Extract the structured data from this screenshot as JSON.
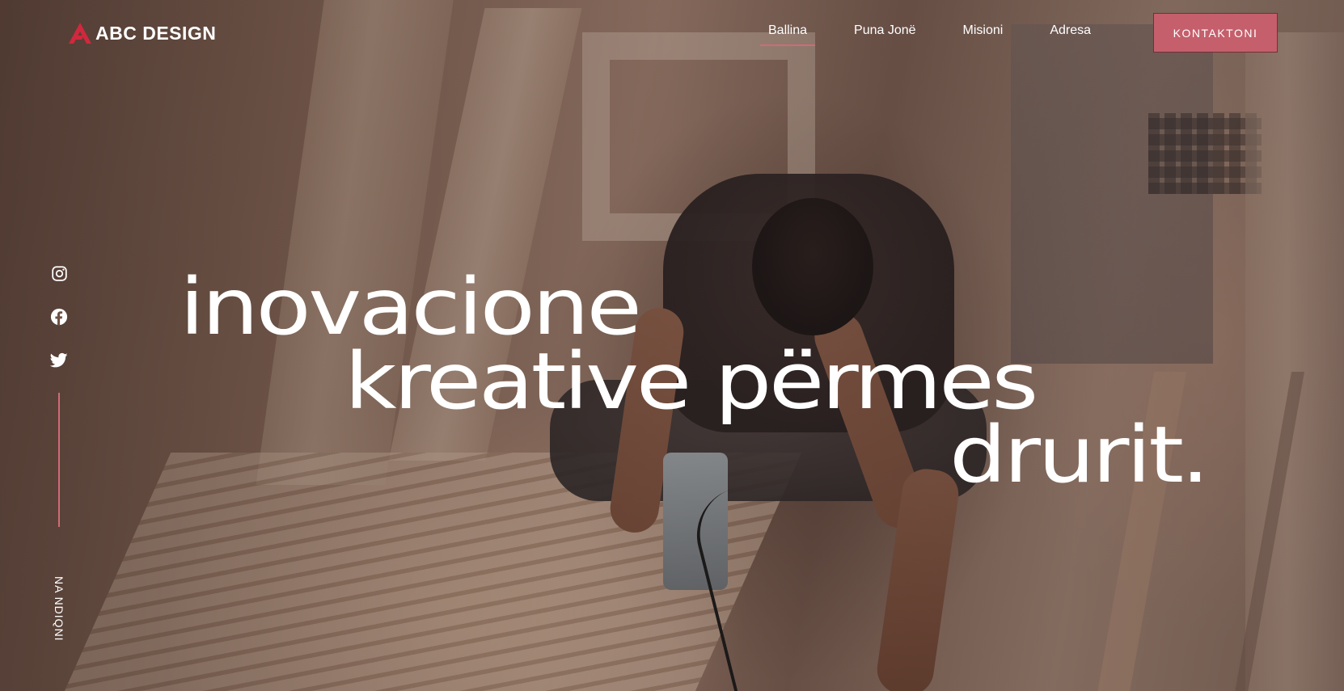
{
  "brand": {
    "name": "ABC DESIGN",
    "accent_color": "#d06b78",
    "button_color": "#c55f6c",
    "logo_icon": "abc-logo-mark"
  },
  "nav": {
    "items": [
      {
        "label": "Ballina",
        "active": true
      },
      {
        "label": "Puna Jonë",
        "active": false
      },
      {
        "label": "Misioni",
        "active": false
      },
      {
        "label": "Adresa",
        "active": false
      }
    ],
    "cta": "KONTAKTONI"
  },
  "social": {
    "icons": [
      "instagram-icon",
      "facebook-icon",
      "twitter-icon"
    ],
    "follow_label": "NA NDIQNI"
  },
  "hero": {
    "line1": "inovacione",
    "line2": "kreative përmes",
    "line3": "drurit."
  }
}
